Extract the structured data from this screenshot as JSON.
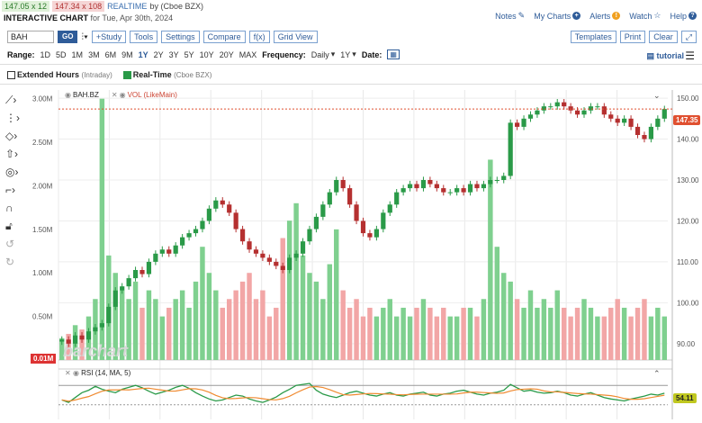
{
  "quote": {
    "bid": "147.05 x 12",
    "ask": "147.34 x 108",
    "realtime": "REALTIME",
    "source": "by (Cboe BZX)"
  },
  "title": {
    "main": "INTERACTIVE CHART",
    "date": "for Tue, Apr 30th, 2024"
  },
  "links": {
    "notes": "Notes",
    "my_charts": "My Charts",
    "alerts": "Alerts",
    "watch": "Watch",
    "help": "Help"
  },
  "toolbar": {
    "symbol": "BAH",
    "go": "GO",
    "study": "+Study",
    "tools": "Tools",
    "settings": "Settings",
    "compare": "Compare",
    "fx": "f(x)",
    "grid": "Grid View",
    "templates": "Templates",
    "print": "Print",
    "clear": "Clear"
  },
  "range": {
    "label": "Range:",
    "options": [
      "1D",
      "5D",
      "1M",
      "3M",
      "6M",
      "9M",
      "1Y",
      "2Y",
      "3Y",
      "5Y",
      "10Y",
      "20Y",
      "MAX"
    ],
    "active": "1Y",
    "frequency_label": "Frequency:",
    "frequency": "Daily",
    "period": "1Y",
    "date_label": "Date:",
    "tutorial": "tutorial"
  },
  "options": {
    "extended": "Extended Hours",
    "extended_note": "(Intraday)",
    "realtime": "Real-Time",
    "realtime_note": "(Cboe BZX)"
  },
  "legend": {
    "symbol": "BAH.BZ",
    "vol": "VOL (LikeMain)",
    "rsi": "RSI (14, MA, 5)"
  },
  "tags": {
    "price": "147.35",
    "rsi": "54.11",
    "vol": "0.01M"
  },
  "watermark": "barchart",
  "colors": {
    "up": "#2a9a48",
    "down": "#b53030",
    "vol_up": "#7fd08f",
    "vol_down": "#f2a6a6",
    "accent": "#2f5c99"
  },
  "chart_data": {
    "type": "candlestick",
    "right_axis_ticks": [
      150,
      140,
      130,
      120,
      110,
      100,
      90
    ],
    "left_axis_ticks": [
      "3.00M",
      "2.50M",
      "2.00M",
      "1.50M",
      "1.00M",
      "0.50M"
    ],
    "price_ylim": [
      86,
      152
    ],
    "vol_ylim": [
      0,
      3.1
    ],
    "close": [
      91,
      90,
      92,
      91,
      93,
      94,
      95,
      99,
      103,
      104,
      106,
      108,
      107,
      110,
      112,
      113,
      112,
      114,
      116,
      117,
      118,
      120,
      123,
      125,
      124,
      122,
      118,
      115,
      113,
      112,
      111,
      110,
      109,
      108,
      111,
      112,
      115,
      118,
      121,
      124,
      127,
      130,
      128,
      124,
      120,
      117,
      116,
      118,
      122,
      124,
      127,
      128,
      129,
      128,
      130,
      129,
      128,
      127,
      127,
      128,
      127,
      129,
      128,
      129,
      130,
      130,
      131,
      144,
      143,
      145,
      146,
      147,
      148,
      148,
      149,
      148,
      147,
      146,
      147,
      148,
      148,
      146,
      145,
      144,
      145,
      143,
      141,
      140,
      143,
      145,
      147.35
    ],
    "volume": [
      0.25,
      0.3,
      0.4,
      0.35,
      0.5,
      0.7,
      3.0,
      1.2,
      1.0,
      0.8,
      0.7,
      0.9,
      0.6,
      0.8,
      0.7,
      0.5,
      0.6,
      0.7,
      0.8,
      0.6,
      0.9,
      1.3,
      1.0,
      0.8,
      0.6,
      0.7,
      0.8,
      0.9,
      1.0,
      0.7,
      0.8,
      0.5,
      0.6,
      1.4,
      1.6,
      1.8,
      1.2,
      1.0,
      0.9,
      0.7,
      1.1,
      1.5,
      0.8,
      0.6,
      0.7,
      0.5,
      0.6,
      0.5,
      0.6,
      0.7,
      0.5,
      0.6,
      0.5,
      0.6,
      0.7,
      0.6,
      0.5,
      0.6,
      0.5,
      0.5,
      0.6,
      0.6,
      0.5,
      0.7,
      2.3,
      1.3,
      1.0,
      0.9,
      0.7,
      0.6,
      0.8,
      0.6,
      0.7,
      0.6,
      0.8,
      0.6,
      0.5,
      0.6,
      0.7,
      0.6,
      0.5,
      0.5,
      0.6,
      0.7,
      0.6,
      0.5,
      0.6,
      0.7,
      0.5,
      0.6,
      0.5
    ],
    "rsi": [
      40,
      35,
      45,
      55,
      60,
      68,
      62,
      58,
      55,
      62,
      66,
      70,
      65,
      58,
      52,
      56,
      60,
      66,
      70,
      64,
      55,
      48,
      42,
      38,
      40,
      45,
      50,
      48,
      42,
      38,
      35,
      40,
      46,
      55,
      62,
      70,
      72,
      74,
      60,
      52,
      48,
      45,
      50,
      55,
      58,
      54,
      50,
      48,
      52,
      55,
      50,
      48,
      52,
      54,
      56,
      50,
      48,
      52,
      54,
      58,
      60,
      56,
      52,
      50,
      54,
      56,
      60,
      72,
      65,
      58,
      60,
      56,
      54,
      55,
      58,
      55,
      50,
      48,
      52,
      55,
      50,
      45,
      42,
      40,
      38,
      42,
      45,
      48,
      52,
      50,
      54
    ]
  }
}
